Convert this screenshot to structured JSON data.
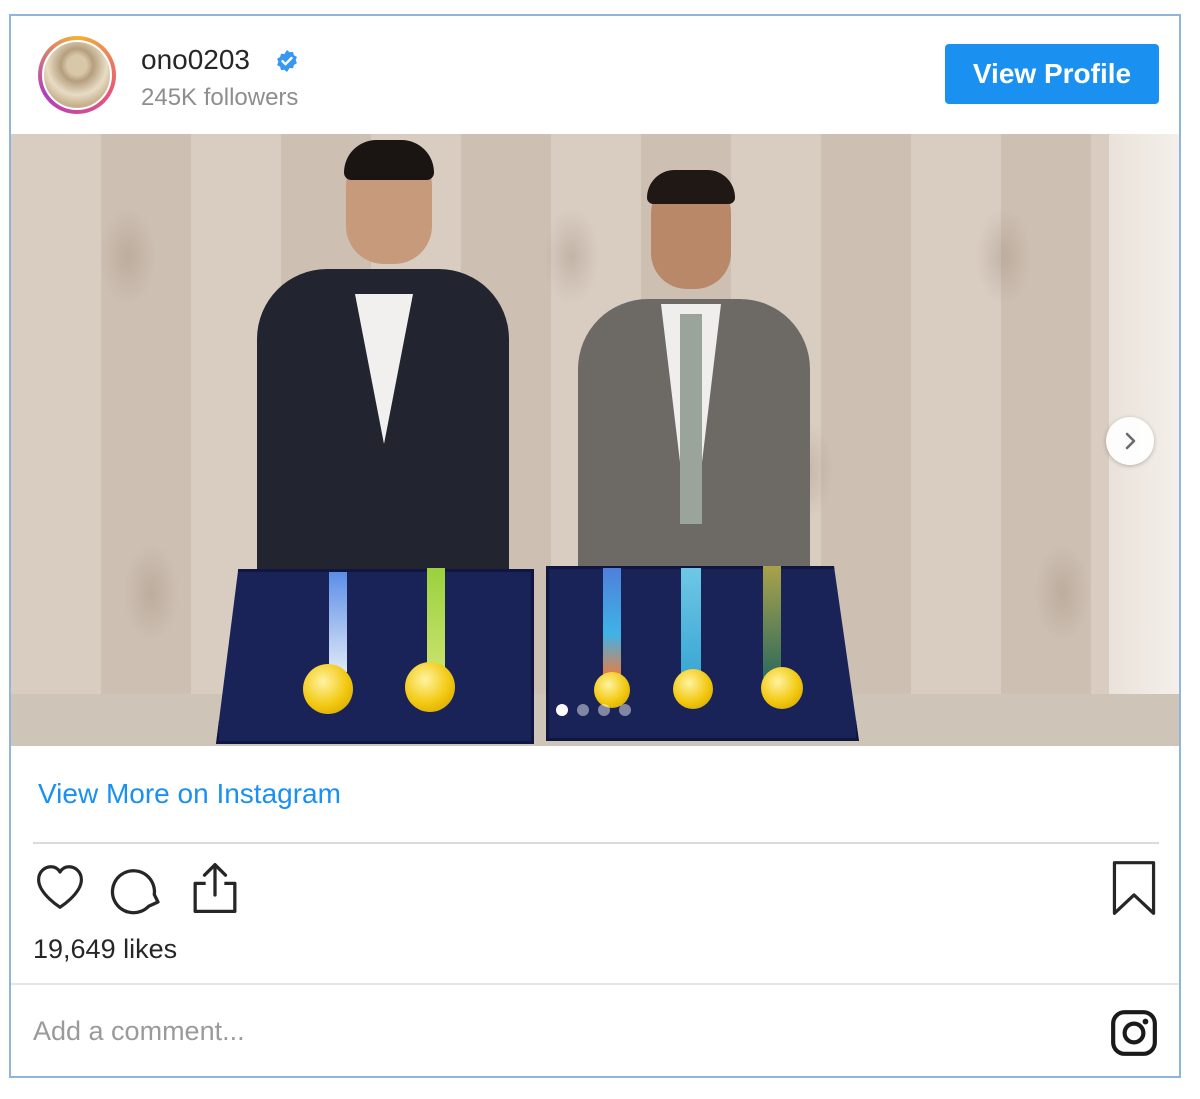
{
  "post": {
    "username": "ono0203",
    "followers": "245K followers",
    "view_profile_label": "View Profile",
    "view_more_label": "View More on Instagram",
    "likes": "19,649 likes",
    "comment_placeholder": "Add a comment...",
    "carousel": {
      "slides": 4,
      "active": 1
    }
  },
  "icons": [
    "verified-icon",
    "chevron-right-icon",
    "heart-icon",
    "comment-icon",
    "share-icon",
    "bookmark-icon",
    "instagram-icon"
  ],
  "colors": {
    "accent": "#1a91f0",
    "text": "#262626",
    "muted": "#8e8e8e",
    "border": "#8fb6d8"
  }
}
